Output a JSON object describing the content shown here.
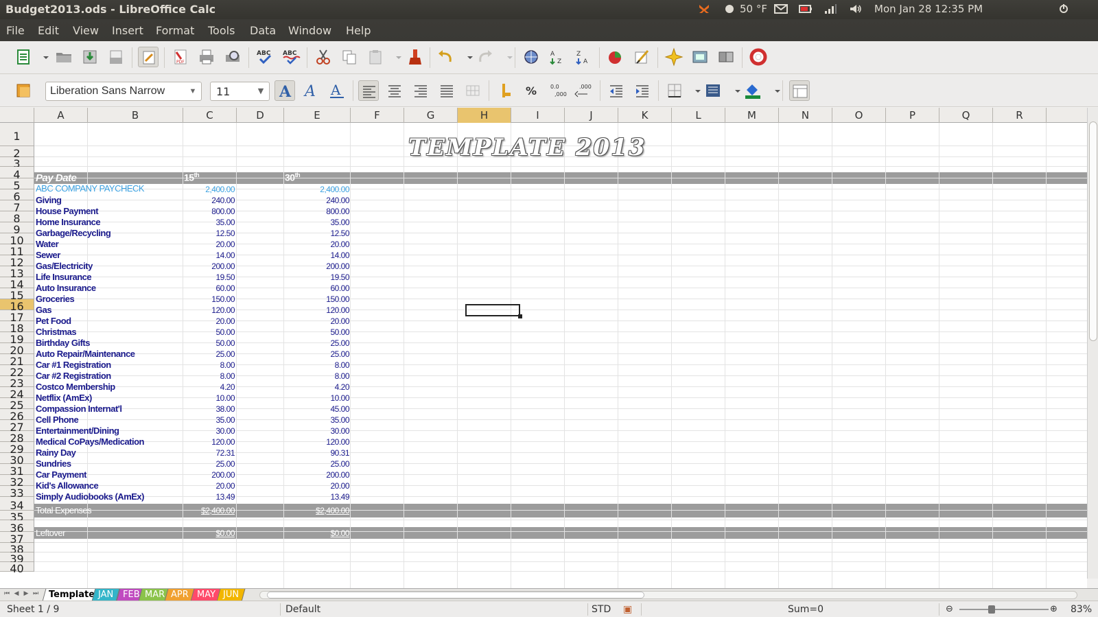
{
  "window": {
    "title": "Budget2013.ods - LibreOffice Calc"
  },
  "tray": {
    "weather": "50 °F",
    "datetime": "Mon Jan 28 12:35 PM"
  },
  "menu": [
    "File",
    "Edit",
    "View",
    "Insert",
    "Format",
    "Tools",
    "Data",
    "Window",
    "Help"
  ],
  "format_bar": {
    "font_name": "Liberation Sans Narrow",
    "font_size": "11"
  },
  "columns": [
    "A",
    "B",
    "C",
    "D",
    "E",
    "F",
    "G",
    "H",
    "I",
    "J",
    "K",
    "L",
    "M",
    "N",
    "O",
    "P",
    "Q",
    "R"
  ],
  "selected_column": "H",
  "selected_row": "16",
  "rows": [
    "1",
    "2",
    "3",
    "4",
    "5",
    "6",
    "7",
    "8",
    "9",
    "10",
    "11",
    "12",
    "13",
    "14",
    "15",
    "16",
    "17",
    "18",
    "19",
    "20",
    "21",
    "22",
    "23",
    "24",
    "25",
    "26",
    "27",
    "28",
    "29",
    "30",
    "31",
    "32",
    "33",
    "34",
    "35",
    "36",
    "37",
    "38",
    "39",
    "40"
  ],
  "sheet": {
    "title": "TEMPLATE 2013",
    "pay_date_label": "Pay Date",
    "col_15": "15",
    "col_30": "30",
    "ordinal_suffix": "th",
    "income": {
      "label": "ABC COMPANY PAYCHECK",
      "v15": "2,400.00",
      "v30": "2,400.00"
    },
    "items": [
      {
        "label": "Giving",
        "v15": "240.00",
        "v30": "240.00"
      },
      {
        "label": "House Payment",
        "v15": "800.00",
        "v30": "800.00"
      },
      {
        "label": "Home Insurance",
        "v15": "35.00",
        "v30": "35.00"
      },
      {
        "label": "Garbage/Recycling",
        "v15": "12.50",
        "v30": "12.50"
      },
      {
        "label": "Water",
        "v15": "20.00",
        "v30": "20.00"
      },
      {
        "label": "Sewer",
        "v15": "14.00",
        "v30": "14.00"
      },
      {
        "label": "Gas/Electricity",
        "v15": "200.00",
        "v30": "200.00"
      },
      {
        "label": "Life Insurance",
        "v15": "19.50",
        "v30": "19.50"
      },
      {
        "label": "Auto Insurance",
        "v15": "60.00",
        "v30": "60.00"
      },
      {
        "label": "Groceries",
        "v15": "150.00",
        "v30": "150.00"
      },
      {
        "label": "Gas",
        "v15": "120.00",
        "v30": "120.00"
      },
      {
        "label": "Pet Food",
        "v15": "20.00",
        "v30": "20.00"
      },
      {
        "label": "Christmas",
        "v15": "50.00",
        "v30": "50.00"
      },
      {
        "label": "Birthday Gifts",
        "v15": "50.00",
        "v30": "25.00"
      },
      {
        "label": "Auto Repair/Maintenance",
        "v15": "25.00",
        "v30": "25.00"
      },
      {
        "label": "Car #1 Registration",
        "v15": "8.00",
        "v30": "8.00"
      },
      {
        "label": "Car #2 Registration",
        "v15": "8.00",
        "v30": "8.00"
      },
      {
        "label": "Costco Membership",
        "v15": "4.20",
        "v30": "4.20"
      },
      {
        "label": "Netflix (AmEx)",
        "v15": "10.00",
        "v30": "10.00"
      },
      {
        "label": "Compassion Internat'l",
        "v15": "38.00",
        "v30": "45.00"
      },
      {
        "label": "Cell Phone",
        "v15": "35.00",
        "v30": "35.00"
      },
      {
        "label": "Entertainment/Dining",
        "v15": "30.00",
        "v30": "30.00"
      },
      {
        "label": "Medical CoPays/Medication",
        "v15": "120.00",
        "v30": "120.00"
      },
      {
        "label": "Rainy Day",
        "v15": "72.31",
        "v30": "90.31"
      },
      {
        "label": "Sundries",
        "v15": "25.00",
        "v30": "25.00"
      },
      {
        "label": "Car Payment",
        "v15": "200.00",
        "v30": "200.00"
      },
      {
        "label": "Kid's Allowance",
        "v15": "20.00",
        "v30": "20.00"
      },
      {
        "label": "Simply Audiobooks (AmEx)",
        "v15": "13.49",
        "v30": "13.49"
      }
    ],
    "total": {
      "label": "Total Expenses",
      "v15": "$2,400.00",
      "v30": "$2,400.00"
    },
    "leftover": {
      "label": "Leftover",
      "v15": "$0.00",
      "v30": "$0.00"
    }
  },
  "tabs": [
    {
      "label": "Template",
      "color": "#ffffff"
    },
    {
      "label": "JAN",
      "color": "#33b5c9"
    },
    {
      "label": "FEB",
      "color": "#c04bc0"
    },
    {
      "label": "MAR",
      "color": "#8bc34a"
    },
    {
      "label": "APR",
      "color": "#f0a030"
    },
    {
      "label": "MAY",
      "color": "#ff4a6a"
    },
    {
      "label": "JUN",
      "color": "#f2b600"
    }
  ],
  "status": {
    "sheet": "Sheet 1 / 9",
    "style": "Default",
    "mode": "STD",
    "sum": "Sum=0",
    "zoom": "83%"
  }
}
